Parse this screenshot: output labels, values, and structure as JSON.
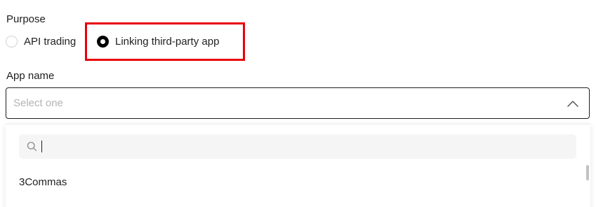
{
  "form": {
    "purpose_label": "Purpose",
    "purpose_options": [
      {
        "label": "API trading",
        "checked": false
      },
      {
        "label": "Linking third-party app",
        "checked": true
      }
    ],
    "app_name_label": "App name",
    "app_name_placeholder": "Select one"
  },
  "dropdown": {
    "search_value": "",
    "options": [
      "3Commas"
    ]
  },
  "colors": {
    "highlight": "#e8000b",
    "radio_checked": "#000000",
    "placeholder": "#b3b3b3"
  }
}
